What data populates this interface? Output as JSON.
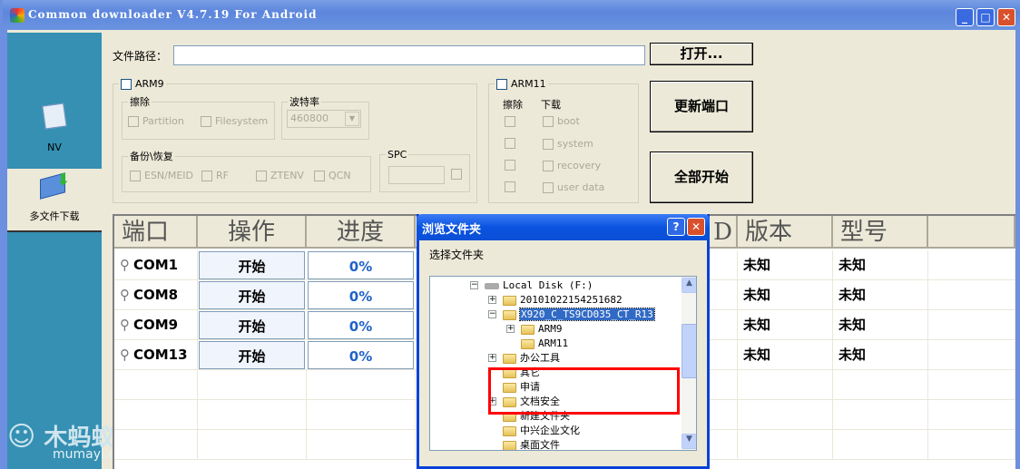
{
  "window": {
    "title": "Common downloader V4.7.19 For Android",
    "controls": [
      "minimize",
      "maximize",
      "close"
    ]
  },
  "sidebar": {
    "items": [
      {
        "label": "NV",
        "icon": "notepad-icon"
      },
      {
        "label": "多文件下载",
        "icon": "download-icon",
        "selected": true
      }
    ]
  },
  "watermark": {
    "text": "木蚂蚁",
    "url": "mumayi.com"
  },
  "path": {
    "label": "文件路径：",
    "value": "",
    "open_button": "打开..."
  },
  "arm9": {
    "label": "ARM9",
    "checked": false,
    "erase": {
      "label": "擦除",
      "options": [
        "Partition",
        "Filesystem"
      ]
    },
    "baud": {
      "label": "波特率",
      "value": "460800"
    },
    "backup": {
      "label": "备份\\恢复",
      "options": [
        "ESN/MEID",
        "RF",
        "ZTENV",
        "QCN"
      ]
    },
    "spc": {
      "label": "SPC",
      "value": ""
    }
  },
  "arm11": {
    "label": "ARM11",
    "checked": false,
    "erase_label": "擦除",
    "download_label": "下载",
    "options": [
      "boot",
      "system",
      "recovery",
      "user data"
    ]
  },
  "buttons": {
    "refresh_ports": "更新端口",
    "start_all": "全部开始"
  },
  "table": {
    "headers": [
      "端口",
      "操作",
      "进度",
      "D",
      "版本",
      "型号"
    ],
    "rows": [
      {
        "port": "COM1",
        "action": "开始",
        "progress": "0%",
        "version": "未知",
        "model": "未知"
      },
      {
        "port": "COM8",
        "action": "开始",
        "progress": "0%",
        "version": "未知",
        "model": "未知"
      },
      {
        "port": "COM9",
        "action": "开始",
        "progress": "0%",
        "version": "未知",
        "model": "未知"
      },
      {
        "port": "COM13",
        "action": "开始",
        "progress": "0%",
        "version": "未知",
        "model": "未知"
      }
    ]
  },
  "dialog": {
    "title": "浏览文件夹",
    "prompt": "选择文件夹",
    "tree": [
      "Local Disk (F:)",
      "20101022154251682",
      "X920_C_TS9CD035_CT_R13",
      "ARM9",
      "ARM11",
      "办公工具",
      "其它",
      "申请",
      "文档安全",
      "新建文件夹",
      "中兴企业文化",
      "桌面文件"
    ],
    "selected": "X920_C_TS9CD035_CT_R13"
  },
  "colors": {
    "sidebar": "#3590b3",
    "titlebar": "#5c86dc",
    "highlight": "#316ac5",
    "annotation": "#ff0000",
    "progress_text": "#2062c9"
  }
}
